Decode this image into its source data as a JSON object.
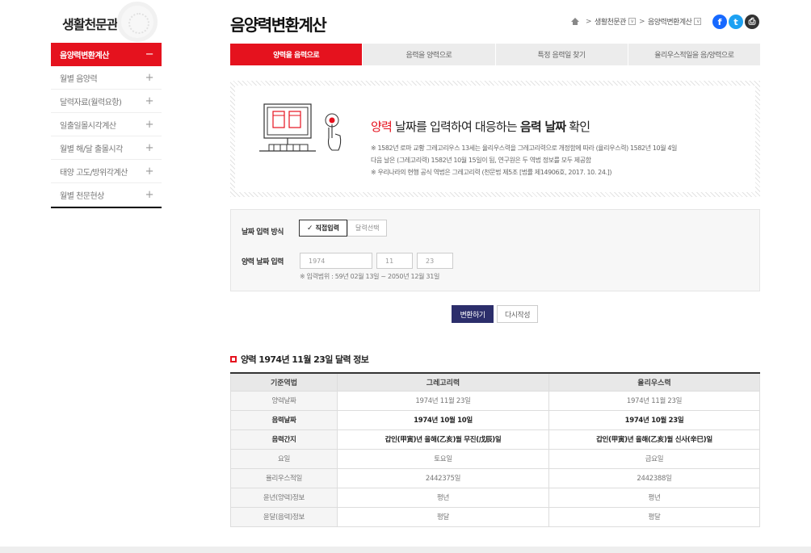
{
  "sidebar": {
    "title": "생활천문관",
    "items": [
      {
        "label": "음양력변환계산",
        "toggle": "−"
      },
      {
        "label": "월별 음양력",
        "toggle": "+"
      },
      {
        "label": "달력자료(월력요항)",
        "toggle": "+"
      },
      {
        "label": "일출일몰시각계산",
        "toggle": "+"
      },
      {
        "label": "월별 해/달 출몰시각",
        "toggle": "+"
      },
      {
        "label": "태양 고도/방위각계산",
        "toggle": "+"
      },
      {
        "label": "월별 천문현상",
        "toggle": "+"
      }
    ]
  },
  "header": {
    "title": "음양력변환계산",
    "breadcrumb": [
      "생활천문관",
      "음양력변환계산"
    ],
    "separator": ">",
    "dropdown_glyph": "v",
    "social": {
      "facebook": "f",
      "twitter": "t",
      "print": "⎙"
    }
  },
  "tabs": [
    {
      "label": "양력을 음력으로"
    },
    {
      "label": "음력을 양력으로"
    },
    {
      "label": "특정 음력일 찾기"
    },
    {
      "label": "율리우스적일을 음/양력으로"
    }
  ],
  "info": {
    "heading_red": "양력",
    "heading_mid": " 날짜를 입력하여 대응하는 ",
    "heading_bold": "음력 날짜",
    "heading_end": " 확인",
    "note1": "※ 1582년 로마 교황 그레고리우스 13세는 율리우스력을 그레고리력으로 개정함에 따라 (율리우스력) 1582년 10월 4일",
    "note2": "다음 날은 (그레고리력) 1582년 10월 15일이 됨, 연구원은 두 역법 정보를 모두 제공함",
    "note3": "※ 우리나라의 현행 공식 역법은 그레고리력 (천문법 제5조 [법률 제14906호, 2017. 10. 24.])"
  },
  "form": {
    "method_label": "날짜 입력 방식",
    "method_options": [
      "직접입력",
      "달력선택"
    ],
    "date_label": "양력 날짜 입력",
    "year": "1974",
    "month": "11",
    "day": "23",
    "hint": "※ 입력범위 : 59년 02월 13일 ~ 2050년 12월 31일"
  },
  "buttons": {
    "convert": "변환하기",
    "reset": "다시작성"
  },
  "result": {
    "title": "양력 1974년 11월 23일 달력 정보",
    "headers": [
      "기준역법",
      "그레고리력",
      "율리우스력"
    ],
    "rows": [
      [
        "양력날짜",
        "1974년 11월 23일",
        "1974년 11월 23일"
      ],
      [
        "음력날짜",
        "1974년 10월 10일",
        "1974년 10월 23일"
      ],
      [
        "음력간지",
        "갑인(甲寅)년 을해(乙亥)월 무진(戊辰)일",
        "갑인(甲寅)년 을해(乙亥)월 신사(辛巳)일"
      ],
      [
        "요일",
        "토요일",
        "금요일"
      ],
      [
        "율리우스적일",
        "2442375일",
        "2442388일"
      ],
      [
        "윤년(양력)정보",
        "평년",
        "평년"
      ],
      [
        "윤달(음력)정보",
        "평달",
        "평달"
      ]
    ]
  },
  "colors": {
    "accent": "#e5121e",
    "primary_button": "#2c2e6b"
  }
}
